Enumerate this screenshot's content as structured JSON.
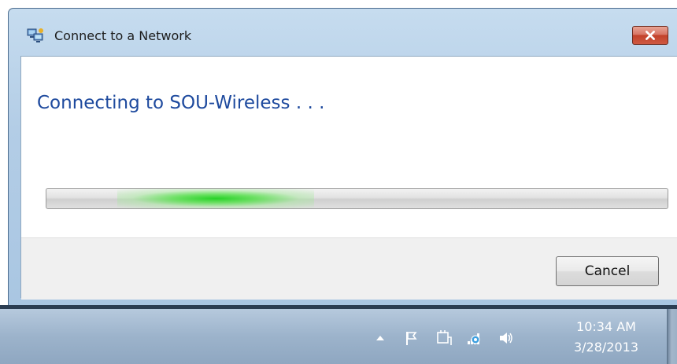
{
  "window": {
    "title": "Connect to a Network",
    "close_tooltip": "Close"
  },
  "content": {
    "heading": "Connecting to SOU-Wireless . . .",
    "progress": {
      "state": "indeterminate",
      "glow_color": "#22d022"
    }
  },
  "footer": {
    "cancel_label": "Cancel"
  },
  "taskbar": {
    "tray_icons": [
      "show-hidden-icons-arrow-icon",
      "action-center-flag-icon",
      "power-plug-icon",
      "network-signal-icon",
      "volume-speaker-icon"
    ],
    "clock": {
      "time": "10:34 AM",
      "date": "3/28/2013"
    }
  },
  "colors": {
    "heading": "#1e4a9e",
    "close_button": "#c2412a",
    "taskbar": "#9cb3cb"
  }
}
